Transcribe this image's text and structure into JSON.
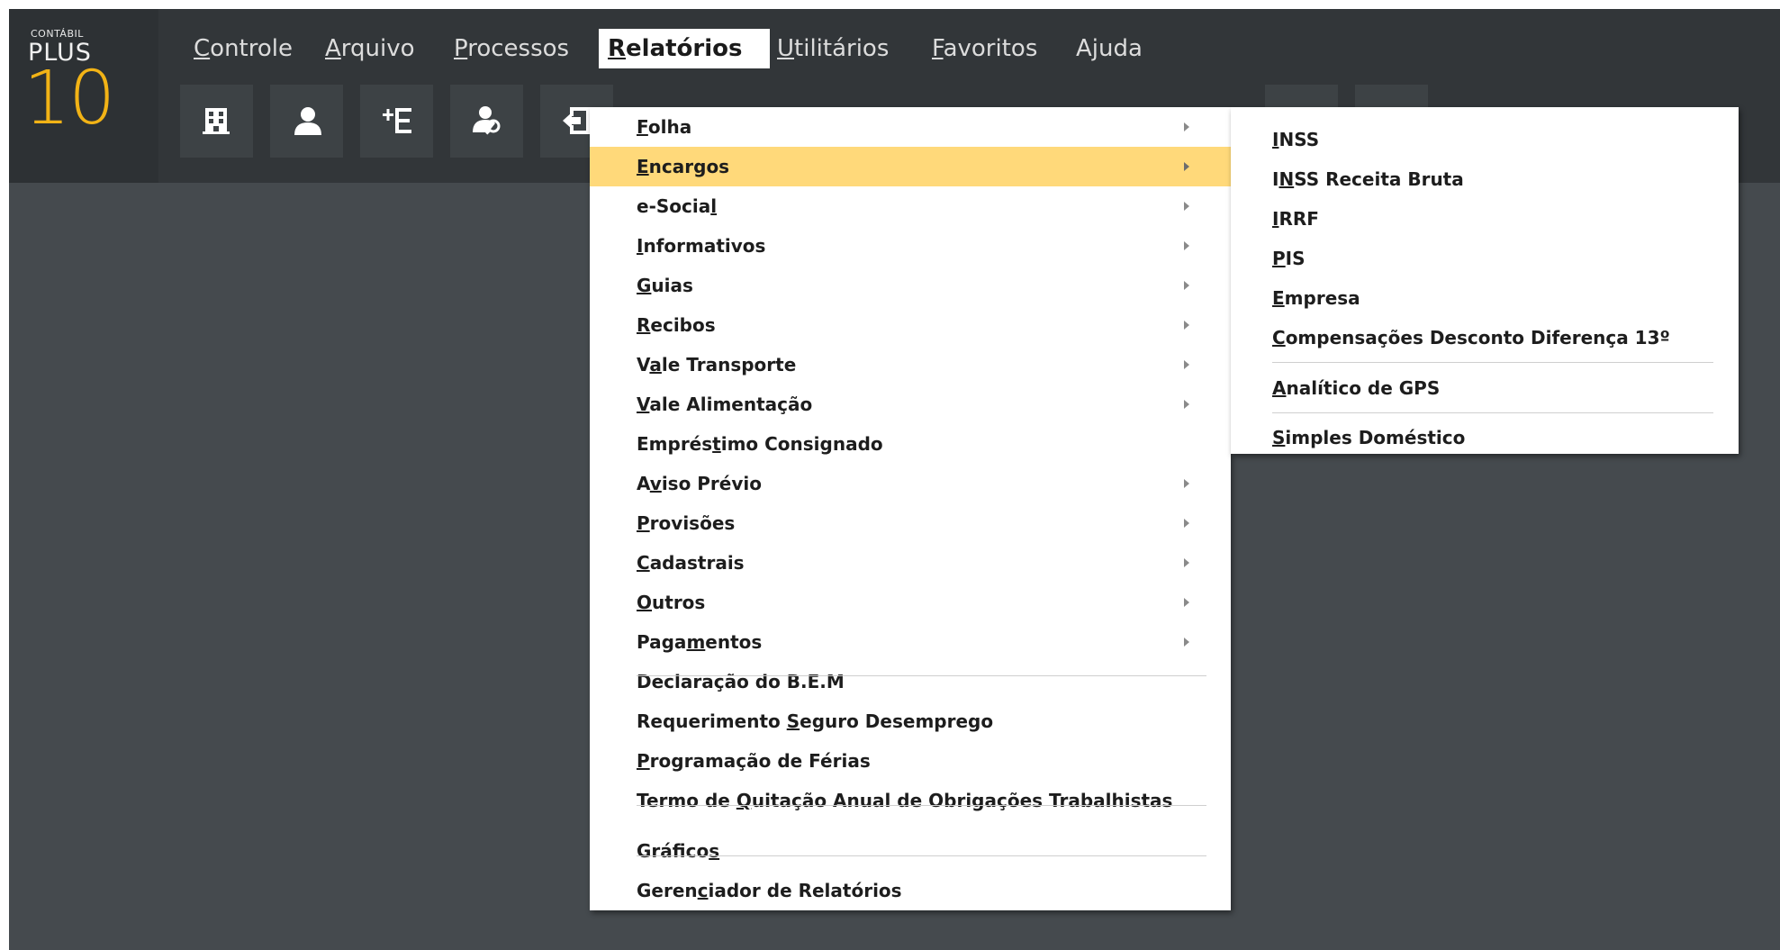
{
  "logo": {
    "small": "CONTÁBIL",
    "plus": "PLUS",
    "version": "10"
  },
  "menubar": {
    "controle": {
      "u": "C",
      "rest": "ontrole"
    },
    "arquivo": {
      "u": "A",
      "rest": "rquivo"
    },
    "processos": {
      "u": "P",
      "rest": "rocessos"
    },
    "relatorios": {
      "u": "R",
      "rest": "elatórios"
    },
    "utilitarios": {
      "u": "U",
      "rest": "tilitários"
    },
    "favoritos": {
      "u": "F",
      "rest": "avoritos"
    },
    "ajuda": {
      "pre": "A",
      "u": "j",
      "rest": "uda"
    }
  },
  "toolbar": {
    "icons": [
      "building-icon",
      "user-icon",
      "add-list-icon",
      "user-search-icon",
      "import-icon",
      "chart-icon",
      "document-icon"
    ]
  },
  "menu": {
    "folha": {
      "pre": "",
      "u": "F",
      "rest": "olha"
    },
    "encargos": {
      "pre": "",
      "u": "E",
      "rest": "ncargos"
    },
    "esocial": {
      "pre": "e-Socia",
      "u": "l",
      "rest": ""
    },
    "informativos": {
      "pre": "",
      "u": "I",
      "rest": "nformativos"
    },
    "guias": {
      "pre": "",
      "u": "G",
      "rest": "uias"
    },
    "recibos": {
      "pre": "",
      "u": "R",
      "rest": "ecibos"
    },
    "vale_transporte": {
      "pre": "V",
      "u": "a",
      "rest": "le Transporte"
    },
    "vale_alimentacao": {
      "pre": "",
      "u": "V",
      "rest": "ale Alimentação"
    },
    "emprestimo": {
      "pre": "Emprés",
      "u": "t",
      "rest": "imo Consignado"
    },
    "aviso_previo": {
      "pre": "A",
      "u": "v",
      "rest": "iso Prévio"
    },
    "provisoes": {
      "pre": "",
      "u": "P",
      "rest": "rovisões"
    },
    "cadastrais": {
      "pre": "",
      "u": "C",
      "rest": "adastrais"
    },
    "outros": {
      "pre": "",
      "u": "O",
      "rest": "utros"
    },
    "pagamentos": {
      "pre": "Paga",
      "u": "m",
      "rest": "entos"
    },
    "declaracao_bem": {
      "pre": "Declaração do B.E.M",
      "u": "",
      "rest": ""
    },
    "seguro_desemprego": {
      "pre": "Requerimento ",
      "u": "S",
      "rest": "eguro Desemprego"
    },
    "programacao_ferias": {
      "pre": "",
      "u": "P",
      "rest": "rogramação de Férias"
    },
    "termo_quitacao": {
      "pre": "Termo de ",
      "u": "Q",
      "rest": "uitação Anual de Obrigações Trabalhistas"
    },
    "graficos": {
      "pre": "Gráfico",
      "u": "s",
      "rest": ""
    },
    "gerenciador": {
      "pre": "Geren",
      "u": "c",
      "rest": "iador de Relatórios"
    }
  },
  "submenu": {
    "inss": {
      "pre": "",
      "u": "I",
      "rest": "NSS"
    },
    "inss_receita": {
      "pre": "I",
      "u": "N",
      "rest": "SS Receita Bruta"
    },
    "irrf": {
      "pre": "",
      "u": "I",
      "rest": "RRF"
    },
    "pis": {
      "pre": "",
      "u": "P",
      "rest": "IS"
    },
    "empresa": {
      "pre": "",
      "u": "E",
      "rest": "mpresa"
    },
    "compensacoes": {
      "pre": "",
      "u": "C",
      "rest": "ompensações Desconto Diferença 13º"
    },
    "analitico_gps": {
      "pre": "",
      "u": "A",
      "rest": "nalítico de GPS"
    },
    "simples_domestico": {
      "pre": "",
      "u": "S",
      "rest": "imples Doméstico"
    }
  }
}
